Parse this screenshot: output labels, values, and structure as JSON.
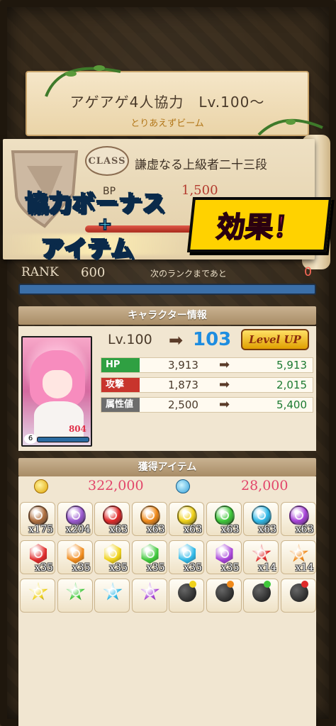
{
  "quest": {
    "title": "アゲアゲ4人協力　Lv.100～",
    "subtitle": "とりあえずビーム"
  },
  "class": {
    "badge": "CLASS",
    "name": "謙虚なる上級者二十三段",
    "bp_label": "BP",
    "bp_value": "1,500"
  },
  "promo": {
    "line1": "協力ボーナス",
    "plus": "+",
    "line2": "アイテム",
    "effect": "効果！"
  },
  "rank": {
    "label": "RANK",
    "value": "600",
    "next_label": "次のランクまであと",
    "next_value": "0",
    "progress": 1.0
  },
  "character": {
    "header": "キャラクター情報",
    "level_old": "Lv.100",
    "level_new": "103",
    "level_up_badge": "Level UP",
    "portrait_number": "804",
    "portrait_level": "6",
    "stats": [
      {
        "label": "HP",
        "old": "3,913",
        "new": "5,913",
        "color": "#2fa042"
      },
      {
        "label": "攻撃",
        "old": "1,873",
        "new": "2,015",
        "color": "#c8342c"
      },
      {
        "label": "属性値",
        "old": "2,500",
        "new": "5,400",
        "color": "#6d6d6d"
      }
    ]
  },
  "items": {
    "header": "獲得アイテム",
    "coins": "322,000",
    "orbs": "28,000",
    "rows": [
      [
        {
          "icon": "multi-gem-icon",
          "color": "#b07040",
          "count": "x175"
        },
        {
          "icon": "rainbow-gem-icon",
          "color": "#9b59d0",
          "count": "x204"
        },
        {
          "icon": "red-gem-icon",
          "color": "#e02a2a",
          "count": "x63"
        },
        {
          "icon": "orange-gem-icon",
          "color": "#f08a1a",
          "count": "x63"
        },
        {
          "icon": "yellow-gem-icon",
          "color": "#f0d21a",
          "count": "x63"
        },
        {
          "icon": "green-gem-icon",
          "color": "#3fc83a",
          "count": "x63"
        },
        {
          "icon": "cyan-gem-icon",
          "color": "#30b9e8",
          "count": "x63"
        },
        {
          "icon": "purple-gem-icon",
          "color": "#a742d8",
          "count": "x63"
        }
      ],
      [
        {
          "icon": "red-crystal-icon",
          "color": "#e02a2a",
          "count": "x35"
        },
        {
          "icon": "orange-crystal-icon",
          "color": "#f08a1a",
          "count": "x35"
        },
        {
          "icon": "yellow-crystal-icon",
          "color": "#f0d21a",
          "count": "x35"
        },
        {
          "icon": "green-crystal-icon",
          "color": "#3fc83a",
          "count": "x35"
        },
        {
          "icon": "cyan-crystal-icon",
          "color": "#30b9e8",
          "count": "x35"
        },
        {
          "icon": "purple-crystal-icon",
          "color": "#a742d8",
          "count": "x35"
        },
        {
          "icon": "red-star-icon",
          "color": "#e02a2a",
          "count": "x14"
        },
        {
          "icon": "orange-star-icon",
          "color": "#f08a1a",
          "count": "x14"
        }
      ],
      [
        {
          "icon": "yellow-star-icon",
          "color": "#f0d21a",
          "count": ""
        },
        {
          "icon": "green-star-icon",
          "color": "#3fc83a",
          "count": ""
        },
        {
          "icon": "cyan-star-icon",
          "color": "#30b9e8",
          "count": ""
        },
        {
          "icon": "purple-star-icon",
          "color": "#a742d8",
          "count": ""
        },
        {
          "icon": "bomb-icon",
          "color": "#f0d21a",
          "count": ""
        },
        {
          "icon": "bomb-icon",
          "color": "#f08a1a",
          "count": ""
        },
        {
          "icon": "bomb-icon",
          "color": "#3fc83a",
          "count": ""
        },
        {
          "icon": "bomb-icon",
          "color": "#e02a2a",
          "count": ""
        }
      ]
    ]
  }
}
